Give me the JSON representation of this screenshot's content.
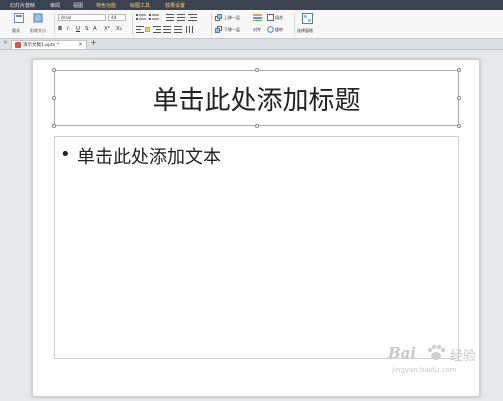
{
  "menubar": {
    "items": [
      {
        "label": "幻灯片放映",
        "highlight": false
      },
      {
        "label": "审阅",
        "highlight": false
      },
      {
        "label": "视图",
        "highlight": false
      },
      {
        "label": "特色功能",
        "highlight": true
      },
      {
        "label": "绘图工具",
        "highlight": true
      },
      {
        "label": "效果设置",
        "highlight": true
      }
    ]
  },
  "ribbon": {
    "layout_label": "版式",
    "shape_size_label": "形状大小",
    "font_name": "Arial",
    "font_size": "44",
    "format_buttons": [
      "B",
      "I",
      "U",
      "S",
      "A",
      "X²",
      "X₂"
    ],
    "move_up_label": "上移一层",
    "move_down_label": "下移一层",
    "combine_label": "组合",
    "align_label": "对齐",
    "rotate_label": "旋转",
    "select_pane_label": "选择窗格"
  },
  "tabs": {
    "active_doc": "演示文稿1.pptx *"
  },
  "slide": {
    "title_placeholder": "单击此处添加标题",
    "bullet": "•",
    "body_placeholder": "单击此处添加文本"
  },
  "watermark": {
    "brand": "Bai",
    "cn": "经验",
    "url": "jingyan.baidu.com"
  }
}
